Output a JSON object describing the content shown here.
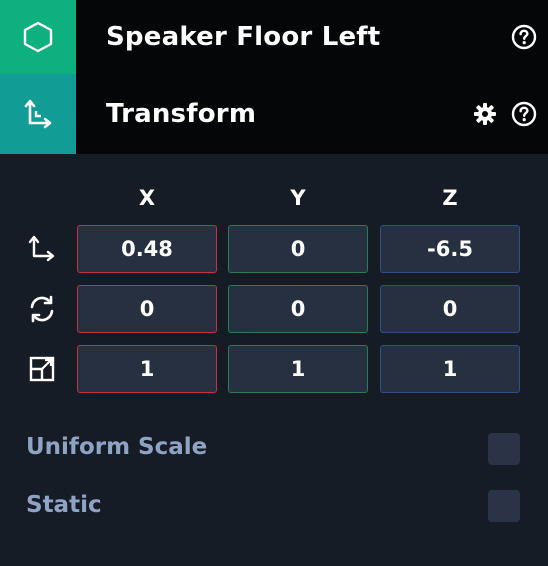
{
  "entity": {
    "title": "Speaker Floor Left",
    "icon": "hexagon-icon",
    "help_icon": "help-icon"
  },
  "component": {
    "title": "Transform",
    "icon": "transform-axis-icon",
    "settings_icon": "gear-icon",
    "help_icon": "help-icon"
  },
  "axes": [
    "X",
    "Y",
    "Z"
  ],
  "rows": [
    {
      "name": "translation",
      "icon": "translate-axis-icon",
      "values": [
        "0.48",
        "0",
        "-6.5"
      ]
    },
    {
      "name": "rotation",
      "icon": "rotate-icon",
      "values": [
        "0",
        "0",
        "0"
      ]
    },
    {
      "name": "scale",
      "icon": "scale-icon",
      "values": [
        "1",
        "1",
        "1"
      ]
    }
  ],
  "properties": [
    {
      "label": "Uniform Scale",
      "checked": false
    },
    {
      "label": "Static",
      "checked": false
    }
  ],
  "colors": {
    "entity_accent": "#0fb07f",
    "component_accent": "#119c96",
    "x_axis": "#c2333e",
    "y_axis": "#2e7a52",
    "z_axis": "#2f4f86",
    "label": "#8fa3c4"
  }
}
